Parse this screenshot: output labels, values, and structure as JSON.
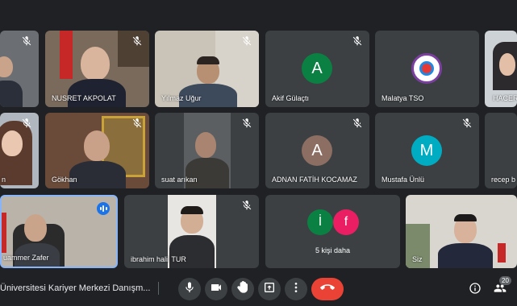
{
  "participants": {
    "row1": [
      {
        "name": "",
        "muted": true
      },
      {
        "name": "NUSRET AKPOLAT",
        "muted": true
      },
      {
        "name": "Yılmaz Uğur",
        "muted": true
      },
      {
        "name": "Akif Gülaçtı",
        "muted": true,
        "initial": "A",
        "color": "#0b8043"
      },
      {
        "name": "Malatya TSO",
        "muted": false
      },
      {
        "name": "HACER",
        "muted": false
      }
    ],
    "row2": [
      {
        "name": "n",
        "muted": true
      },
      {
        "name": "Gökhan",
        "muted": true
      },
      {
        "name": "suat arıkan",
        "muted": true
      },
      {
        "name": "ADNAN FATİH KOCAMAZ",
        "muted": true,
        "initial": "A",
        "color": "#8d6e63"
      },
      {
        "name": "Mustafa Ünlü",
        "muted": true,
        "initial": "M",
        "color": "#00acc1"
      },
      {
        "name": "recep b",
        "muted": true
      }
    ],
    "row3": [
      {
        "name": "uammer Zafer",
        "speaking": true
      },
      {
        "name": "ibrahim halil TUR",
        "muted": true
      },
      {
        "name": "5 kişi daha",
        "initials": [
          "İ",
          "f"
        ],
        "colors": [
          "#0b8043",
          "#e91e63"
        ]
      },
      {
        "name": "Siz",
        "muted": false
      }
    ]
  },
  "meeting": {
    "title": "Üniversitesi Kariyer Merkezi Danışm...",
    "participant_count": "20"
  },
  "controls": {
    "mic": "mic-icon",
    "camera": "camera-icon",
    "hand": "raise-hand-icon",
    "present": "present-icon",
    "more": "more-options-icon",
    "end": "end-call-icon",
    "info": "info-icon",
    "people": "people-icon"
  },
  "colors": {
    "end_call": "#ea4335",
    "speaking": "#1a73e8",
    "speaking_border": "#8ab4f8"
  }
}
